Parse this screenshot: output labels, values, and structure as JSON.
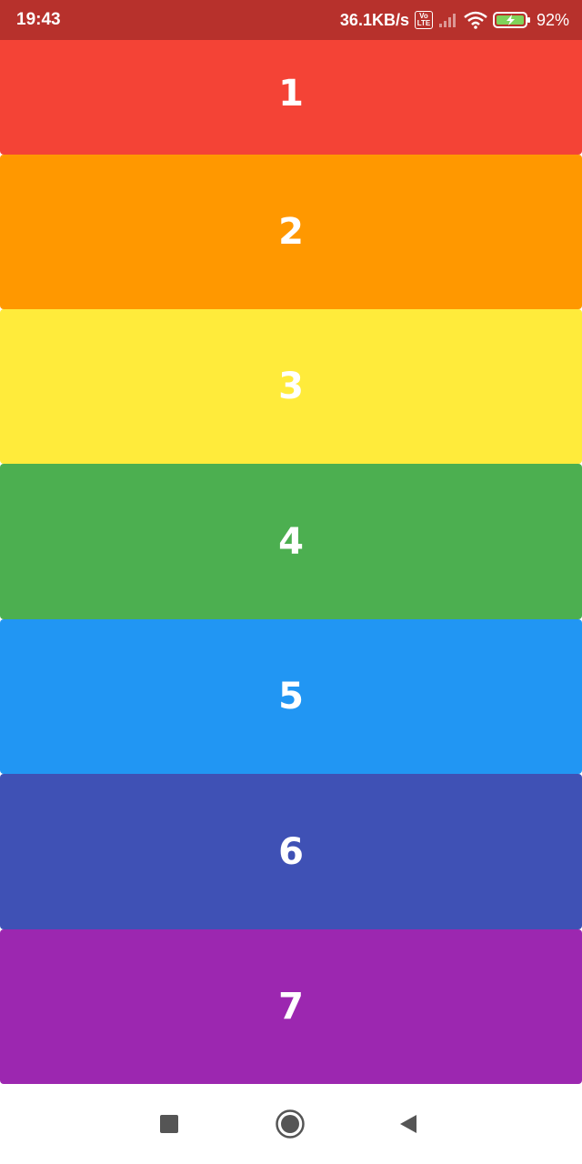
{
  "status_bar": {
    "time": "19:43",
    "net_speed": "36.1KB/s",
    "volte_label": "Vo LTE",
    "battery_percent": "92%",
    "icons": [
      "volte-icon",
      "signal-icon",
      "wifi-icon",
      "battery-charging-icon"
    ],
    "background": "#b7312c"
  },
  "cards": [
    {
      "label": "1",
      "color": "#f44336"
    },
    {
      "label": "2",
      "color": "#ff9800"
    },
    {
      "label": "3",
      "color": "#ffeb3b"
    },
    {
      "label": "4",
      "color": "#4caf50"
    },
    {
      "label": "5",
      "color": "#2196f3"
    },
    {
      "label": "6",
      "color": "#3f51b5"
    },
    {
      "label": "7",
      "color": "#9c27b0"
    }
  ],
  "nav_bar": {
    "icons": [
      "recents-icon",
      "home-icon",
      "back-icon"
    ]
  }
}
